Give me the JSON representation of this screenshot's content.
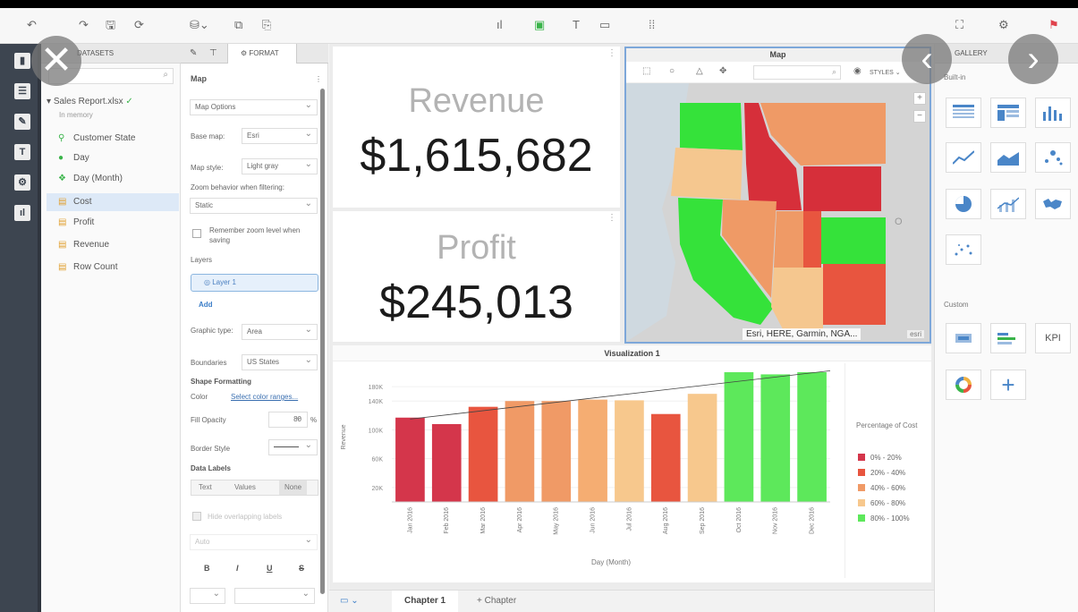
{
  "toolbar": {
    "icons": [
      "undo-icon",
      "redo-icon",
      "save-icon",
      "refresh-icon",
      "add-data-icon",
      "copy-icon",
      "paste-icon",
      "chart-icon",
      "image-icon",
      "text-icon",
      "picture-icon",
      "grid-icon",
      "fullscreen-icon",
      "settings-icon",
      "comment-icon"
    ]
  },
  "datasets": {
    "header": "DATASETS",
    "file": "Sales Report.xlsx",
    "memory": "In memory",
    "fields": [
      {
        "label": "Customer State",
        "icon": "location-icon"
      },
      {
        "label": "Day",
        "icon": "date-icon"
      },
      {
        "label": "Day (Month)",
        "icon": "date-hierarchy-icon"
      },
      {
        "label": "Cost",
        "icon": "metric-icon"
      },
      {
        "label": "Profit",
        "icon": "metric-icon"
      },
      {
        "label": "Revenue",
        "icon": "metric-icon"
      },
      {
        "label": "Row Count",
        "icon": "metric-icon"
      }
    ]
  },
  "format": {
    "tab_label": "FORMAT",
    "title": "Map",
    "map_options": "Map Options",
    "base_map_label": "Base map:",
    "base_map_value": "Esri",
    "map_style_label": "Map style:",
    "map_style_value": "Light gray",
    "zoom_label": "Zoom behavior when filtering:",
    "zoom_value": "Static",
    "remember_label": "Remember zoom level when saving",
    "layers_label": "Layers",
    "layer1": "Layer 1",
    "add": "Add",
    "graphic_type_label": "Graphic type:",
    "graphic_type_value": "Area",
    "boundaries_label": "Boundaries",
    "boundaries_value": "US States",
    "shape_formatting": "Shape Formatting",
    "color_label": "Color",
    "color_link": "Select color ranges...",
    "fill_opacity_label": "Fill Opacity",
    "fill_opacity_value": "80",
    "fill_opacity_unit": "%",
    "border_style_label": "Border Style",
    "data_labels": "Data Labels",
    "seg_text": "Text",
    "seg_values": "Values",
    "seg_none": "None",
    "hide_overlapping": "Hide overlapping labels",
    "auto": "Auto",
    "bold": "B",
    "italic": "I",
    "underline": "U",
    "strike": "S"
  },
  "kpi": {
    "revenue_label": "Revenue",
    "revenue_value": "$1,615,682",
    "profit_label": "Profit",
    "profit_value": "$245,013"
  },
  "map": {
    "title": "Map",
    "styles": "STYLES",
    "attribution": "Esri, HERE, Garmin, NGA...",
    "watermark": "esri",
    "zoom_in": "+",
    "zoom_out": "−",
    "state_colors": {
      "dark_red": "#d62f3a",
      "red": "#e8553f",
      "orange": "#ef9a66",
      "light_orange": "#f5c78f",
      "green": "#35e23a",
      "light_green": "#6fe855"
    }
  },
  "chart_data": {
    "type": "bar",
    "title": "Visualization 1",
    "xlabel": "Day (Month)",
    "ylabel": "Revenue",
    "ylim": [
      0,
      180000
    ],
    "ytick_labels": [
      "180K",
      "140K",
      "100K",
      "60K",
      "20K"
    ],
    "ytick_values": [
      160000,
      140000,
      100000,
      60000,
      20000
    ],
    "categories": [
      "Jan 2016",
      "Feb 2016",
      "Mar 2016",
      "Apr 2016",
      "May 2016",
      "Jun 2016",
      "Jul 2016",
      "Aug 2016",
      "Sep 2016",
      "Oct 2016",
      "Nov 2016",
      "Dec 2016"
    ],
    "values": [
      117000,
      108000,
      132000,
      140000,
      140000,
      142000,
      141000,
      122000,
      150000,
      186000,
      177000,
      181000
    ],
    "colors": [
      "#d4364b",
      "#d4364b",
      "#e8553f",
      "#f09a66",
      "#f09a66",
      "#f5ad72",
      "#f7c88d",
      "#e8553f",
      "#f7c88d",
      "#5de85b",
      "#5de85b",
      "#5de85b"
    ],
    "trendline": {
      "start": 115000,
      "end": 182000
    },
    "legend": {
      "title": "Percentage of Cost",
      "items": [
        {
          "label": "0% - 20%",
          "color": "#d4364b"
        },
        {
          "label": "20% - 40%",
          "color": "#e8553f"
        },
        {
          "label": "40% - 60%",
          "color": "#f09a66"
        },
        {
          "label": "60% - 80%",
          "color": "#f7c88d"
        },
        {
          "label": "80% - 100%",
          "color": "#5de85b"
        }
      ]
    }
  },
  "chapters": {
    "tab1": "Chapter 1",
    "add": "+ Chapter"
  },
  "gallery": {
    "header": "GALLERY",
    "builtin": "Built-in",
    "custom": "Custom",
    "kpi_label": "KPI"
  }
}
